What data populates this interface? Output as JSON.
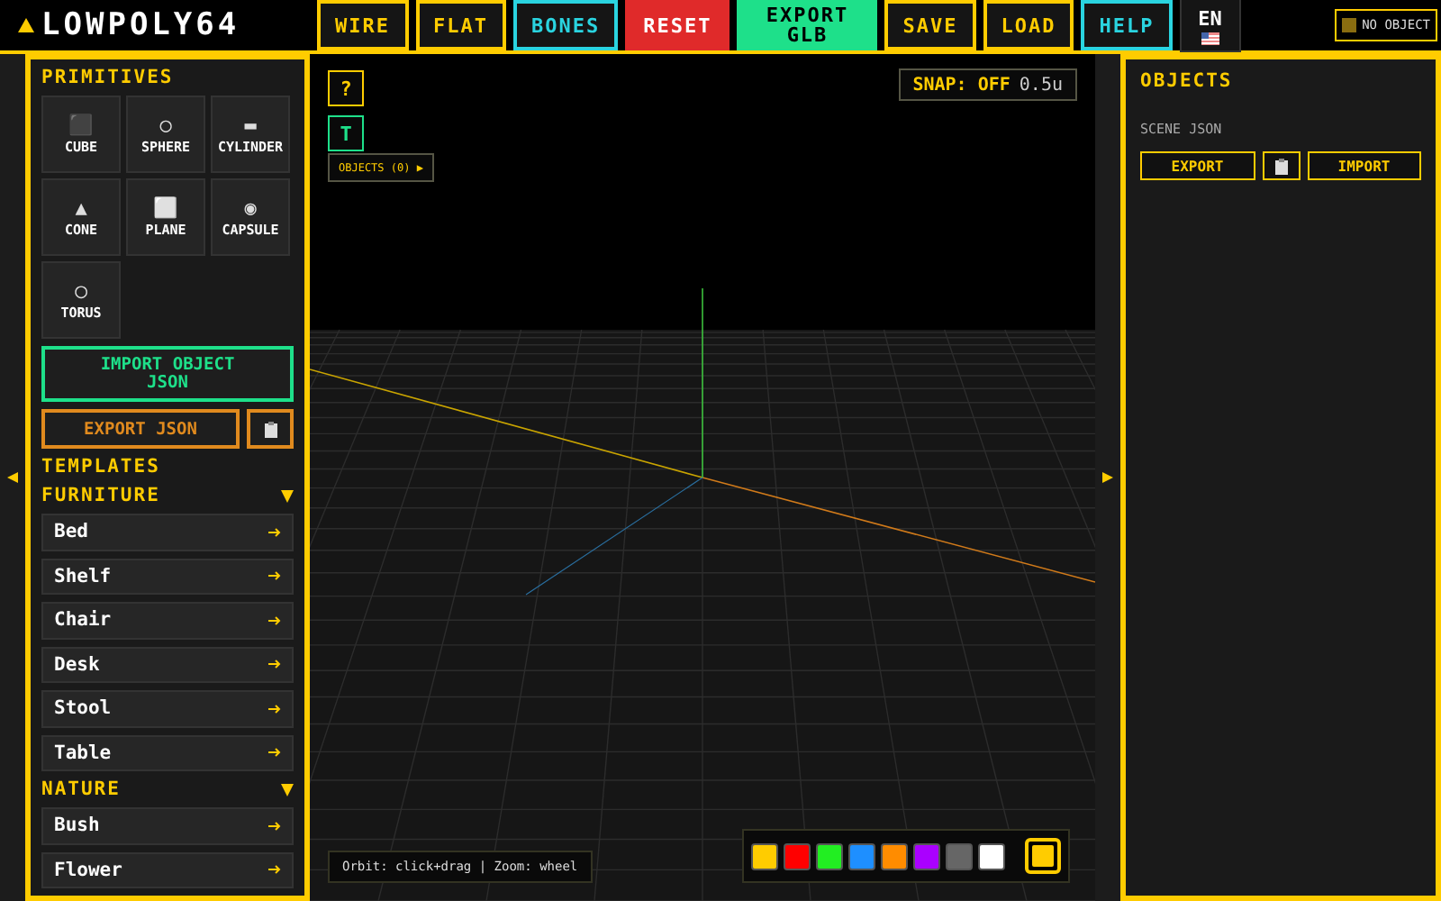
{
  "app": {
    "logo": "LOWPOLY64"
  },
  "toolbar": [
    {
      "label": "WIRE",
      "kind": "outline"
    },
    {
      "label": "FLAT",
      "kind": "outline"
    },
    {
      "label": "BONES",
      "kind": "cyan"
    },
    {
      "label": "RESET",
      "kind": "red"
    },
    {
      "label": "EXPORT GLB",
      "kind": "green"
    },
    {
      "label": "SAVE",
      "kind": "outline"
    },
    {
      "label": "LOAD",
      "kind": "outline"
    },
    {
      "label": "HELP",
      "kind": "cyan"
    }
  ],
  "language": {
    "label": "EN"
  },
  "selection_badge": {
    "label": "NO OBJECT"
  },
  "left_panel": {
    "title": "PRIMITIVES",
    "primitives": [
      {
        "icon": "⬛",
        "label": "CUBE"
      },
      {
        "icon": "○",
        "label": "SPHERE"
      },
      {
        "icon": "▬",
        "label": "CYLINDER"
      },
      {
        "icon": "▲",
        "label": "CONE"
      },
      {
        "icon": "⬜",
        "label": "PLANE"
      },
      {
        "icon": "◉",
        "label": "CAPSULE"
      },
      {
        "icon": "◯",
        "label": "TORUS"
      }
    ],
    "import_button": "IMPORT OBJECT JSON",
    "export_button": "EXPORT JSON",
    "templates_title": "TEMPLATES",
    "categories": [
      {
        "name": "FURNITURE",
        "expanded": true,
        "items": [
          "Bed",
          "Shelf",
          "Chair",
          "Desk",
          "Stool",
          "Table"
        ]
      },
      {
        "name": "NATURE",
        "expanded": true,
        "items": [
          "Bush",
          "Flower"
        ]
      }
    ]
  },
  "viewport": {
    "help_button": "?",
    "text_button": "T",
    "objects_toggle": "OBJECTS (0) ▶",
    "snap": {
      "label": "SNAP:",
      "state": "OFF",
      "step": "0.5u"
    },
    "hint": "Orbit: click+drag | Zoom: wheel",
    "palette": [
      {
        "color": "#ffcc00"
      },
      {
        "color": "#ff0000"
      },
      {
        "color": "#22ee22"
      },
      {
        "color": "#1e8fff"
      },
      {
        "color": "#ff8c00"
      },
      {
        "color": "#aa00ff"
      },
      {
        "color": "#666666"
      },
      {
        "color": "#ffffff"
      }
    ],
    "current_color": {
      "color": "#ffcc00"
    }
  },
  "right_panel": {
    "title": "OBJECTS",
    "section": "SCENE JSON",
    "export_button": "EXPORT",
    "import_button": "IMPORT"
  }
}
